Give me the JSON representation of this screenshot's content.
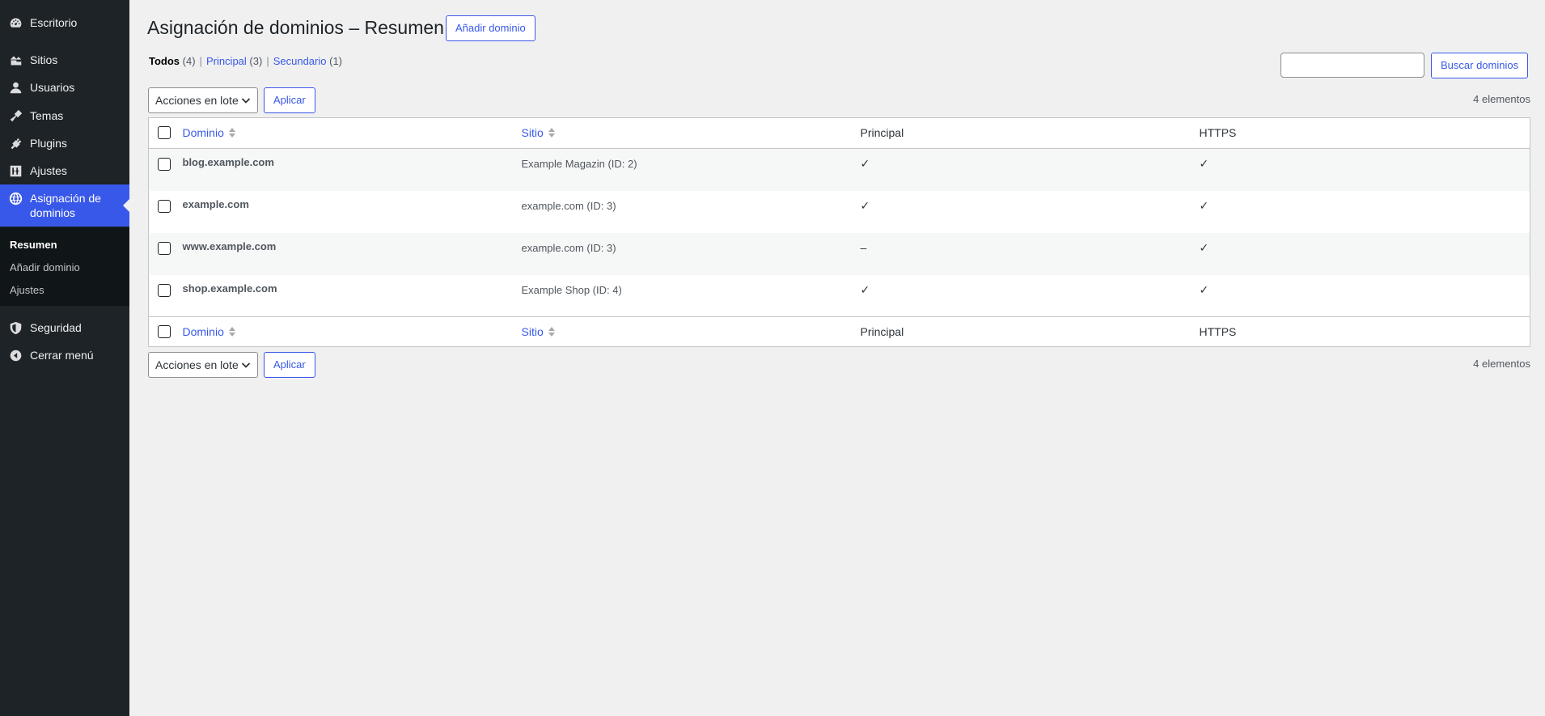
{
  "sidebar": {
    "items": [
      {
        "label": "Escritorio",
        "icon": "dashboard-icon"
      },
      {
        "label": "Sitios",
        "icon": "sites-icon"
      },
      {
        "label": "Usuarios",
        "icon": "users-icon"
      },
      {
        "label": "Temas",
        "icon": "themes-icon"
      },
      {
        "label": "Plugins",
        "icon": "plugins-icon"
      },
      {
        "label": "Ajustes",
        "icon": "settings-icon"
      },
      {
        "label": "Asignación de dominios",
        "icon": "globe-icon"
      },
      {
        "label": "Seguridad",
        "icon": "shield-icon"
      },
      {
        "label": "Cerrar menú",
        "icon": "collapse-icon"
      }
    ],
    "submenu": [
      "Resumen",
      "Añadir dominio",
      "Ajustes"
    ]
  },
  "header": {
    "title": "Asignación de dominios – Resumen",
    "add_button": "Añadir dominio"
  },
  "filters": [
    {
      "label": "Todos",
      "count": "(4)"
    },
    {
      "label": "Principal",
      "count": "(3)"
    },
    {
      "label": "Secundario",
      "count": "(1)"
    }
  ],
  "search": {
    "button": "Buscar dominios",
    "value": ""
  },
  "tablenav": {
    "bulk_action": "Acciones en lote",
    "apply": "Aplicar",
    "count": "4 elementos"
  },
  "table": {
    "columns": [
      "Dominio",
      "Sitio",
      "Principal",
      "HTTPS"
    ],
    "rows": [
      {
        "domain": "blog.example.com",
        "site": "Example Magazin (ID: 2)",
        "primary": "✓",
        "https": "✓"
      },
      {
        "domain": "example.com",
        "site": "example.com (ID: 3)",
        "primary": "✓",
        "https": "✓"
      },
      {
        "domain": "www.example.com",
        "site": "example.com (ID: 3)",
        "primary": "–",
        "https": "✓"
      },
      {
        "domain": "shop.example.com",
        "site": "Example Shop (ID: 4)",
        "primary": "✓",
        "https": "✓"
      }
    ]
  },
  "colors": {
    "sidebar_bg": "#1d2327",
    "accent": "#3858e9",
    "page_bg": "#f0f0f1"
  }
}
